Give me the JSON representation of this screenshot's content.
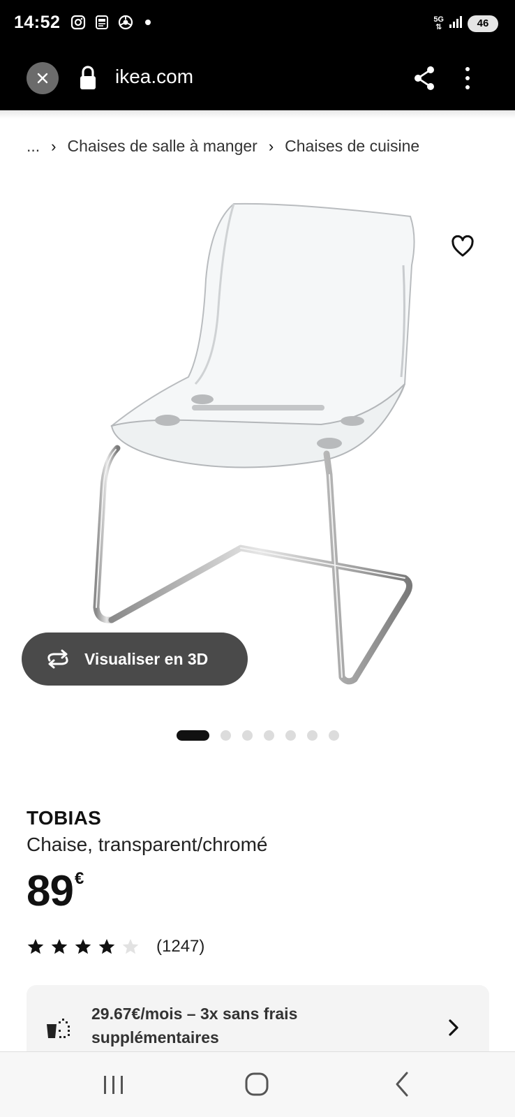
{
  "status_bar": {
    "time": "14:52",
    "network": "5G",
    "battery": "46",
    "icons": [
      "instagram-icon",
      "news-app-icon",
      "chrome-icon",
      "notification-dot",
      "network-5g-icon",
      "signal-icon",
      "battery-icon"
    ]
  },
  "browser": {
    "url": "ikea.com",
    "icons": [
      "close-icon",
      "lock-icon",
      "share-icon",
      "more-vert-icon"
    ]
  },
  "breadcrumb": {
    "items": [
      "...",
      "Chaises de salle à manger",
      "Chaises de cuisine"
    ],
    "separator": "›"
  },
  "gallery": {
    "view_3d_label": "Visualiser en 3D",
    "image_count": 7,
    "active_index": 0
  },
  "product": {
    "name": "TOBIAS",
    "description": "Chaise, transparent/chromé",
    "price": "89",
    "currency": "€",
    "rating": 4,
    "rating_max": 5,
    "rating_count": "(1247)"
  },
  "payment": {
    "text": "29.67€/mois – 3x sans frais supplémentaires"
  },
  "colors": {
    "accent_dark": "#111111",
    "button_3d_bg": "#4a4a4a",
    "payment_bg": "#f4f4f4"
  }
}
